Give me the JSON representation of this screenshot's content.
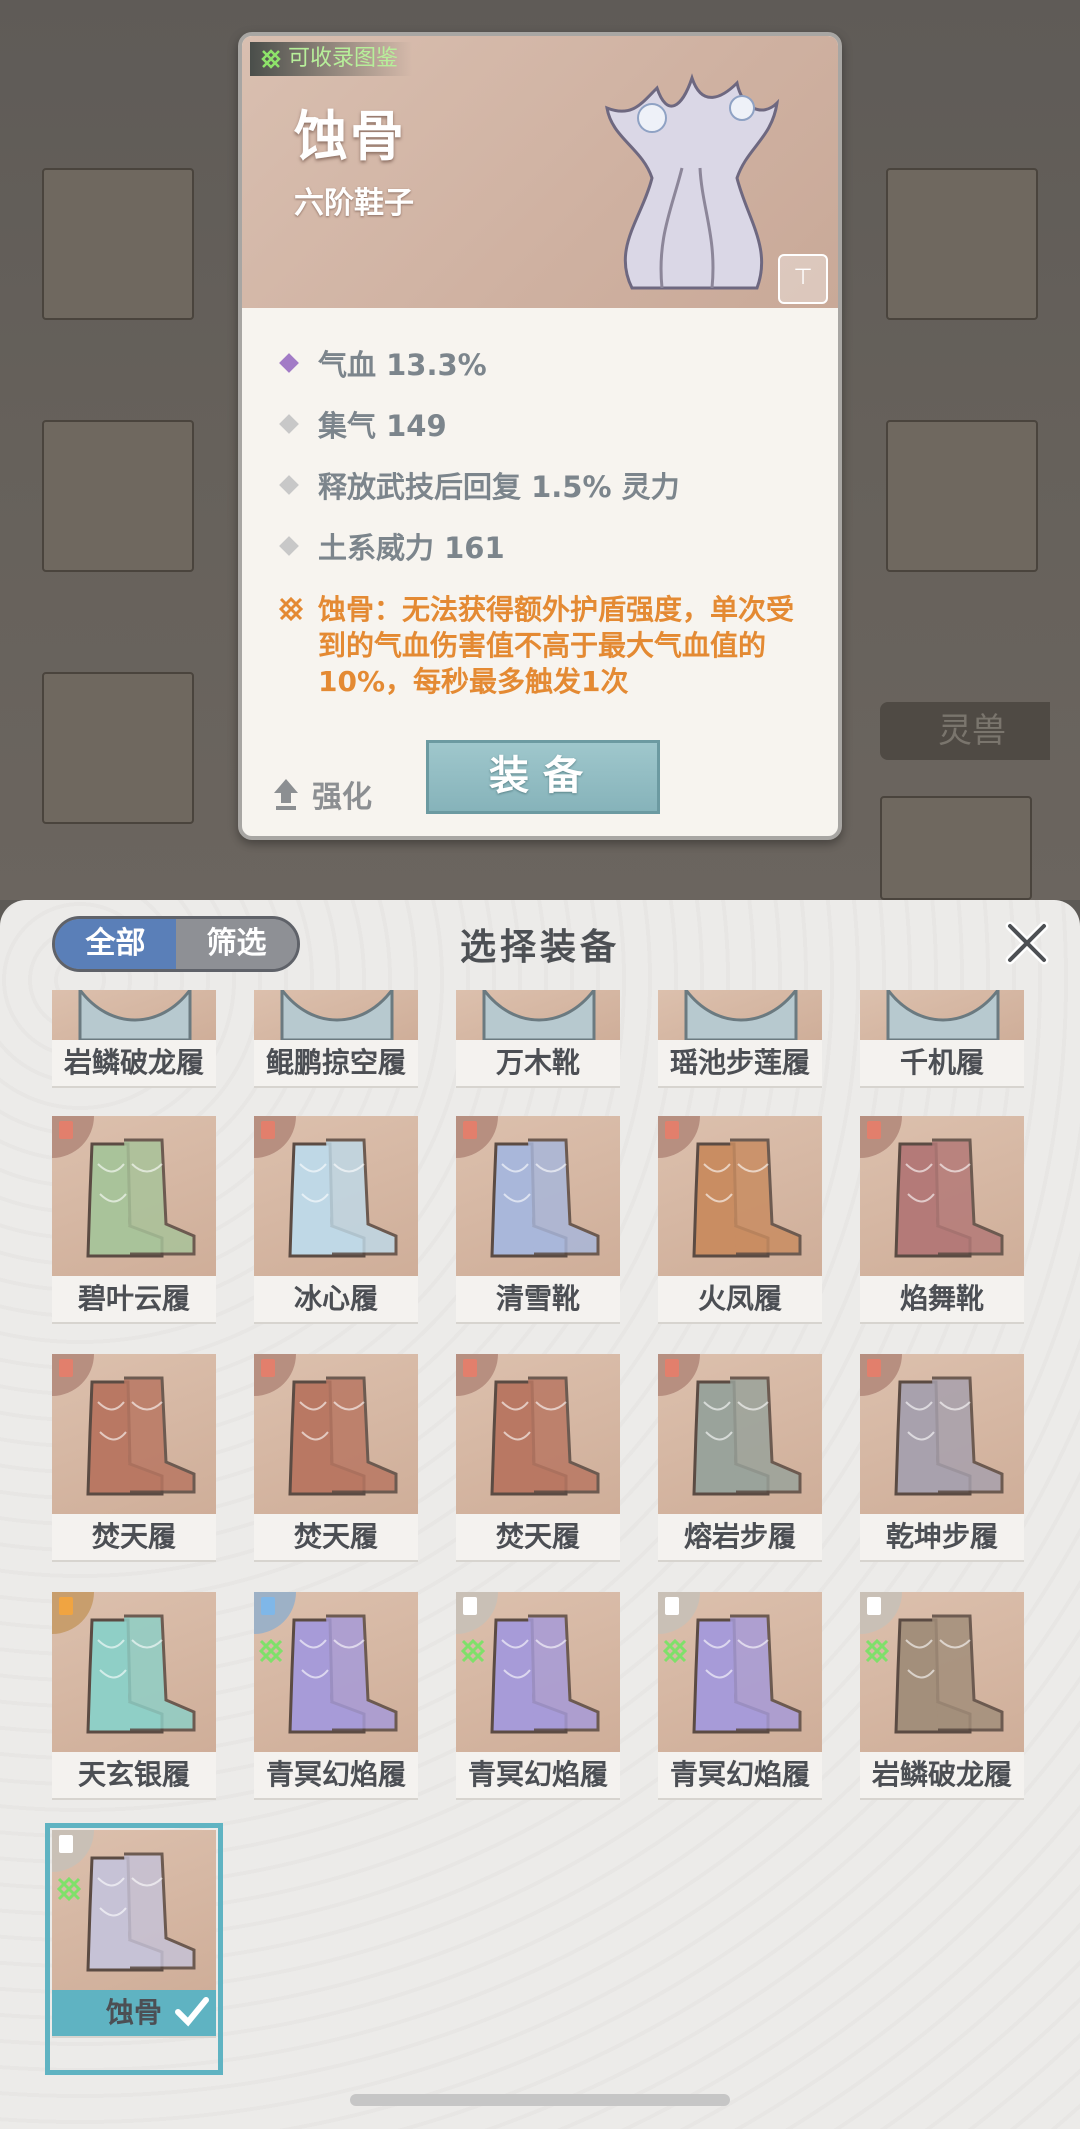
{
  "detail": {
    "collect_label": "可收录图鉴",
    "name": "蚀骨",
    "subtitle": "六阶鞋子",
    "stats": [
      {
        "text": "气血 13.3%",
        "type": "primary"
      },
      {
        "text": "集气 149",
        "type": "secondary"
      },
      {
        "text": "释放武技后回复 1.5% 灵力",
        "type": "secondary"
      },
      {
        "text": "土系威力 161",
        "type": "secondary"
      }
    ],
    "special_text": "蚀骨：无法获得额外护盾强度，单次受到的气血伤害值不高于最大气血值的10%，每秒最多触发1次",
    "enhance_label": "强化",
    "equip_label": "装备"
  },
  "background": {
    "side_tag": "灵兽"
  },
  "sheet": {
    "title": "选择装备",
    "filter_all": "全部",
    "filter_select": "筛选"
  },
  "top_row": [
    "岩鳞破龙履",
    "鲲鹏掠空履",
    "万木靴",
    "瑶池步莲履",
    "千机履"
  ],
  "rows": [
    [
      {
        "name": "碧叶云履",
        "rank": "red",
        "color": "#a9c39a"
      },
      {
        "name": "冰心履",
        "rank": "red",
        "color": "#bfd8e6"
      },
      {
        "name": "清雪靴",
        "rank": "red",
        "color": "#a9b7da"
      },
      {
        "name": "火凤履",
        "rank": "red",
        "color": "#c98d62"
      },
      {
        "name": "焰舞靴",
        "rank": "red",
        "color": "#b47a78"
      }
    ],
    [
      {
        "name": "焚天履",
        "rank": "red",
        "color": "#b97863"
      },
      {
        "name": "焚天履",
        "rank": "red",
        "color": "#b97863"
      },
      {
        "name": "焚天履",
        "rank": "red",
        "color": "#b97863"
      },
      {
        "name": "熔岩步履",
        "rank": "red",
        "color": "#9aa39b"
      },
      {
        "name": "乾坤步履",
        "rank": "red",
        "color": "#a8a1ad"
      }
    ],
    [
      {
        "name": "天玄银履",
        "rank": "orange",
        "color": "#8fcfc6"
      },
      {
        "name": "青冥幻焰履",
        "rank": "blue",
        "color": "#a79bd8"
      },
      {
        "name": "青冥幻焰履",
        "rank": "white",
        "color": "#a79bd8"
      },
      {
        "name": "青冥幻焰履",
        "rank": "white",
        "color": "#a79bd8"
      },
      {
        "name": "岩鳞破龙履",
        "rank": "white",
        "color": "#a38f7b"
      }
    ]
  ],
  "selected_item": {
    "name": "蚀骨",
    "rank": "white",
    "color": "#c6c2d6"
  },
  "colors": {
    "accent_blue": "#5a7fb8",
    "equip_teal": "#86b3ba",
    "special_orange": "#e48a33",
    "collect_green": "#b7ef9a",
    "selected_outline": "#5fb3c2"
  },
  "icons": {
    "collect": "set-knot-icon",
    "enhance": "up-arrow-icon",
    "close": "close-x-icon",
    "selected": "checkmark-icon",
    "corner": "expand-icon"
  }
}
